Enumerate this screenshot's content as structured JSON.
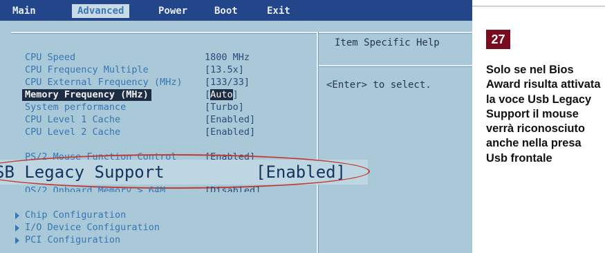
{
  "menu": {
    "items": [
      {
        "label": "Main"
      },
      {
        "label": "Advanced"
      },
      {
        "label": "Power"
      },
      {
        "label": "Boot"
      },
      {
        "label": "Exit"
      }
    ],
    "active": "Advanced"
  },
  "settings": [
    {
      "label": "CPU Speed",
      "value": "1800 MHz"
    },
    {
      "label": "CPU Frequency Multiple",
      "value": "[13.5x]"
    },
    {
      "label": "CPU External Frequency (MHz)",
      "value": "[133/33]"
    },
    {
      "label": "Memory Frequency (MHz)",
      "value_prefix": "[",
      "value_cursor": "Auto",
      "value_suffix": "]"
    },
    {
      "label": "System performance",
      "value": "[Turbo]"
    },
    {
      "label": "CPU Level 1 Cache",
      "value": "[Enabled]"
    },
    {
      "label": "CPU Level 2 Cache",
      "value": "[Enabled]"
    },
    {
      "label": "PS/2 Mouse Function Control",
      "value": "[Enabled]"
    },
    {
      "label": "USB Legacy Support",
      "value": "[Enabled]"
    },
    {
      "label": "OS/2 Onboard Memory > 64M",
      "value": "[Disabled]"
    }
  ],
  "zoom": {
    "label": "SB Legacy Support",
    "value": "[Enabled]"
  },
  "submenus": [
    {
      "label": "Chip Configuration"
    },
    {
      "label": "I/O Device Configuration"
    },
    {
      "label": "PCI Configuration"
    }
  ],
  "help": {
    "title": "Item Specific Help",
    "text": "<Enter> to select."
  },
  "article": {
    "badge": "27",
    "caption": "Solo se nel Bios Award risulta attivata la voce Usb Legacy Support il mouse verrà riconosciuto anche nella presa Usb frontale"
  },
  "colors": {
    "menubar": "#23458a",
    "bios_background": "#a9c8d8",
    "highlight_ellipse": "#c23a32",
    "badge": "#7a0a1e"
  }
}
